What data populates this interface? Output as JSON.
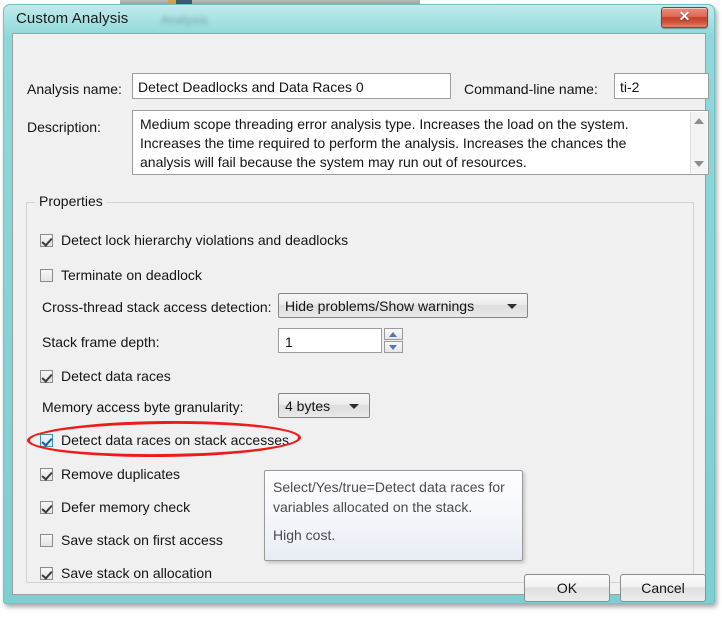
{
  "window": {
    "title": "Custom Analysis",
    "watermark_text": "Analysis",
    "close_label": "✕"
  },
  "form": {
    "analysis_name_label": "Analysis name:",
    "analysis_name_value": "Detect Deadlocks and Data Races 0",
    "analysis_name_placeholder": "Analysis name",
    "cmdline_name_label": "Command-line name:",
    "cmdline_name_value": "ti-2",
    "cmdline_name_placeholder": "Command-line name",
    "description_label": "Description:",
    "description_value": "Medium scope threading error analysis type. Increases the load on the system. Increases the time required to perform the analysis. Increases the chances the analysis will fail because the system may run out of resources.",
    "scroll_up_icon": "scroll-up-arrow-icon",
    "scroll_down_icon": "scroll-down-arrow-icon"
  },
  "properties": {
    "legend": "Properties",
    "rows": [
      {
        "type": "checkbox",
        "label": "Detect lock hierarchy violations and deadlocks",
        "checked": true,
        "hot": false
      },
      {
        "type": "checkbox",
        "label": "Terminate on deadlock",
        "checked": false,
        "hot": false
      },
      {
        "type": "combo",
        "label": "Cross-thread stack access detection:",
        "value": "Hide problems/Show warnings"
      },
      {
        "type": "spinner",
        "label": "Stack frame depth:",
        "value": "1"
      },
      {
        "type": "checkbox",
        "label": "Detect data races",
        "checked": true,
        "hot": false
      },
      {
        "type": "combo",
        "label": "Memory access byte granularity:",
        "value": "4 bytes"
      },
      {
        "type": "checkbox",
        "label": "Detect data races on stack accesses",
        "checked": true,
        "hot": true
      },
      {
        "type": "checkbox",
        "label": "Remove duplicates",
        "checked": true,
        "hot": false
      },
      {
        "type": "checkbox",
        "label": "Defer memory check",
        "checked": true,
        "hot": false
      },
      {
        "type": "checkbox",
        "label": "Save stack on first access",
        "checked": false,
        "hot": false
      },
      {
        "type": "checkbox",
        "label": "Save stack on allocation",
        "checked": true,
        "hot": false
      }
    ]
  },
  "tooltip": {
    "line1": "Select/Yes/true=Detect data races for variables allocated on the stack.",
    "line2": "High cost."
  },
  "footer": {
    "ok_label": "OK",
    "cancel_label": "Cancel"
  },
  "annotation": {
    "shape": "ellipse",
    "color": "#ef1b1b",
    "targets": "Detect data races on stack accesses"
  },
  "colors": {
    "titlebar": "#8ad8d8",
    "client_bg": "#f0f0f0",
    "close_button": "#c73f28",
    "annotation_red": "#ef1b1b",
    "checkbox_hot": "#3d8fbf"
  }
}
